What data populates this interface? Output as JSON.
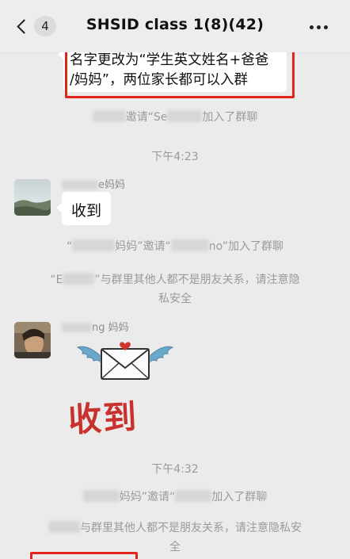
{
  "header": {
    "unread_count": "4",
    "title": "SHSID class 1(8)(42)"
  },
  "messages": {
    "highlighted_text_line1": "名字更改为“学生英文姓名+爸爸",
    "highlighted_text_line2": "/妈妈”，两位家长都可以入群",
    "sys1_mid": "邀请“Se",
    "sys1_tail": "加入了群聊",
    "time1": "下午4:23",
    "msg1_nick_tail": "e妈妈",
    "msg1_text": "收到",
    "sys2_a": "“",
    "sys2_b": "妈妈”邀请“",
    "sys2_c": "no”加入了群聊",
    "sys3_a": "“E",
    "sys3_b": "”与群里其他人都不是朋友关系，请注意隐",
    "sys3_c": "私安全",
    "msg2_nick_tail": "ng 妈妈",
    "sticker_text": "收到",
    "time2": "下午4:32",
    "sys4_a": "妈妈”邀请“",
    "sys4_b": "加入了群聊",
    "sys5_a": "与群里其他人都不是朋友关系，请注意隐私安",
    "sys5_b": "全"
  },
  "colors": {
    "background": "#ebebeb",
    "highlight_red": "#e0251b",
    "sticker_red": "#c8312d"
  },
  "icons": [
    "back-chevron-icon",
    "more-dots-icon",
    "envelope-wings-icon"
  ]
}
